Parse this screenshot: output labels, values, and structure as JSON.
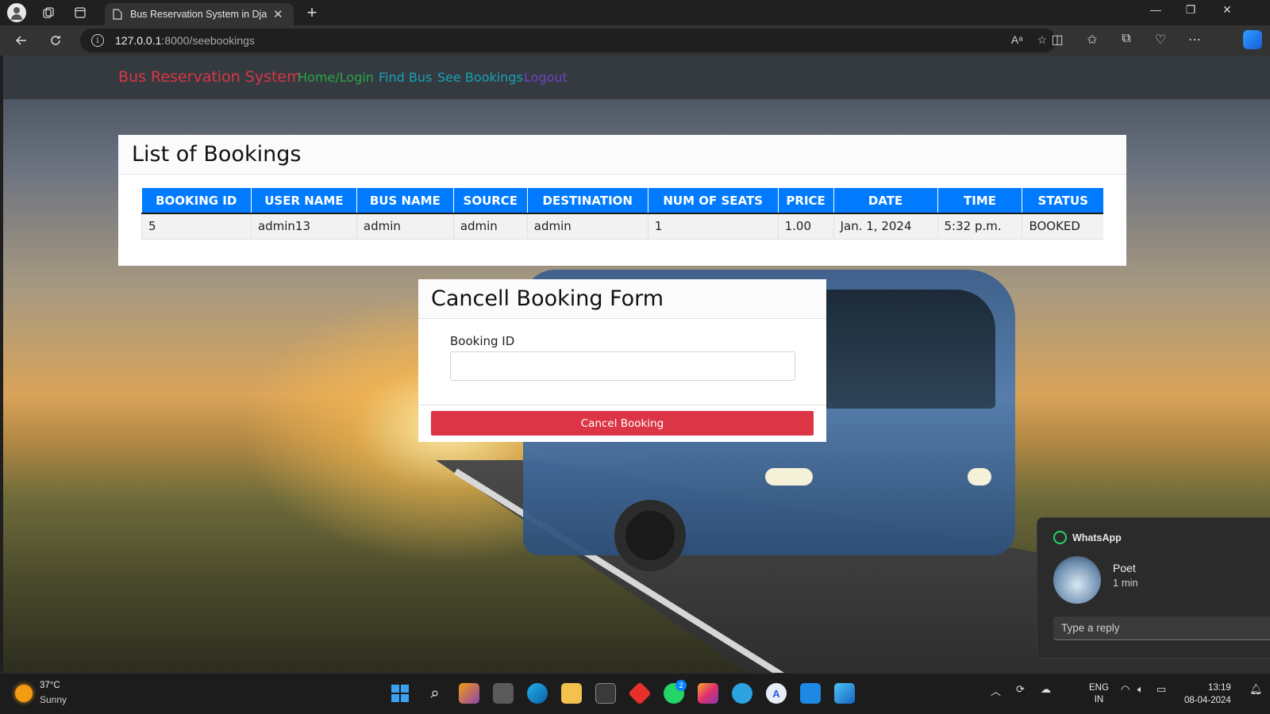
{
  "browser": {
    "tab_title": "Bus Reservation System in Djang",
    "url_host": "127.0.0.1",
    "url_path": ":8000/seebookings"
  },
  "navbar": {
    "brand": "Bus Reservation System",
    "links": [
      {
        "label": "Home/Login",
        "color": "#28a745"
      },
      {
        "label": "Find Bus",
        "color": "#17a2b8"
      },
      {
        "label": "See Bookings",
        "color": "#17a2b8"
      },
      {
        "label": "Logout",
        "color": "#6f42c1"
      }
    ]
  },
  "bookings": {
    "title": "List of Bookings",
    "columns": [
      "BOOKING ID",
      "USER NAME",
      "BUS NAME",
      "SOURCE",
      "DESTINATION",
      "NUM OF SEATS",
      "PRICE",
      "DATE",
      "TIME",
      "STATUS"
    ],
    "rows": [
      [
        "5",
        "admin13",
        "admin",
        "admin",
        "admin",
        "1",
        "1.00",
        "Jan. 1, 2024",
        "5:32 p.m.",
        "BOOKED"
      ]
    ]
  },
  "cancel_form": {
    "title": "Cancell Booking Form",
    "field_label": "Booking ID",
    "field_value": "",
    "button_label": "Cancel Booking"
  },
  "notification": {
    "app": "WhatsApp",
    "sender": "Poet",
    "time": "1 min",
    "reply_placeholder": "Type a reply"
  },
  "taskbar": {
    "temperature": "37°C",
    "condition": "Sunny",
    "whatsapp_badge": "2",
    "language_1": "ENG",
    "language_2": "IN",
    "time": "13:19",
    "date": "08-04-2024"
  },
  "colors": {
    "brand": "#dc3545",
    "table_header": "#007bff",
    "cancel_button": "#dc3545",
    "navbar": "#343a40"
  }
}
